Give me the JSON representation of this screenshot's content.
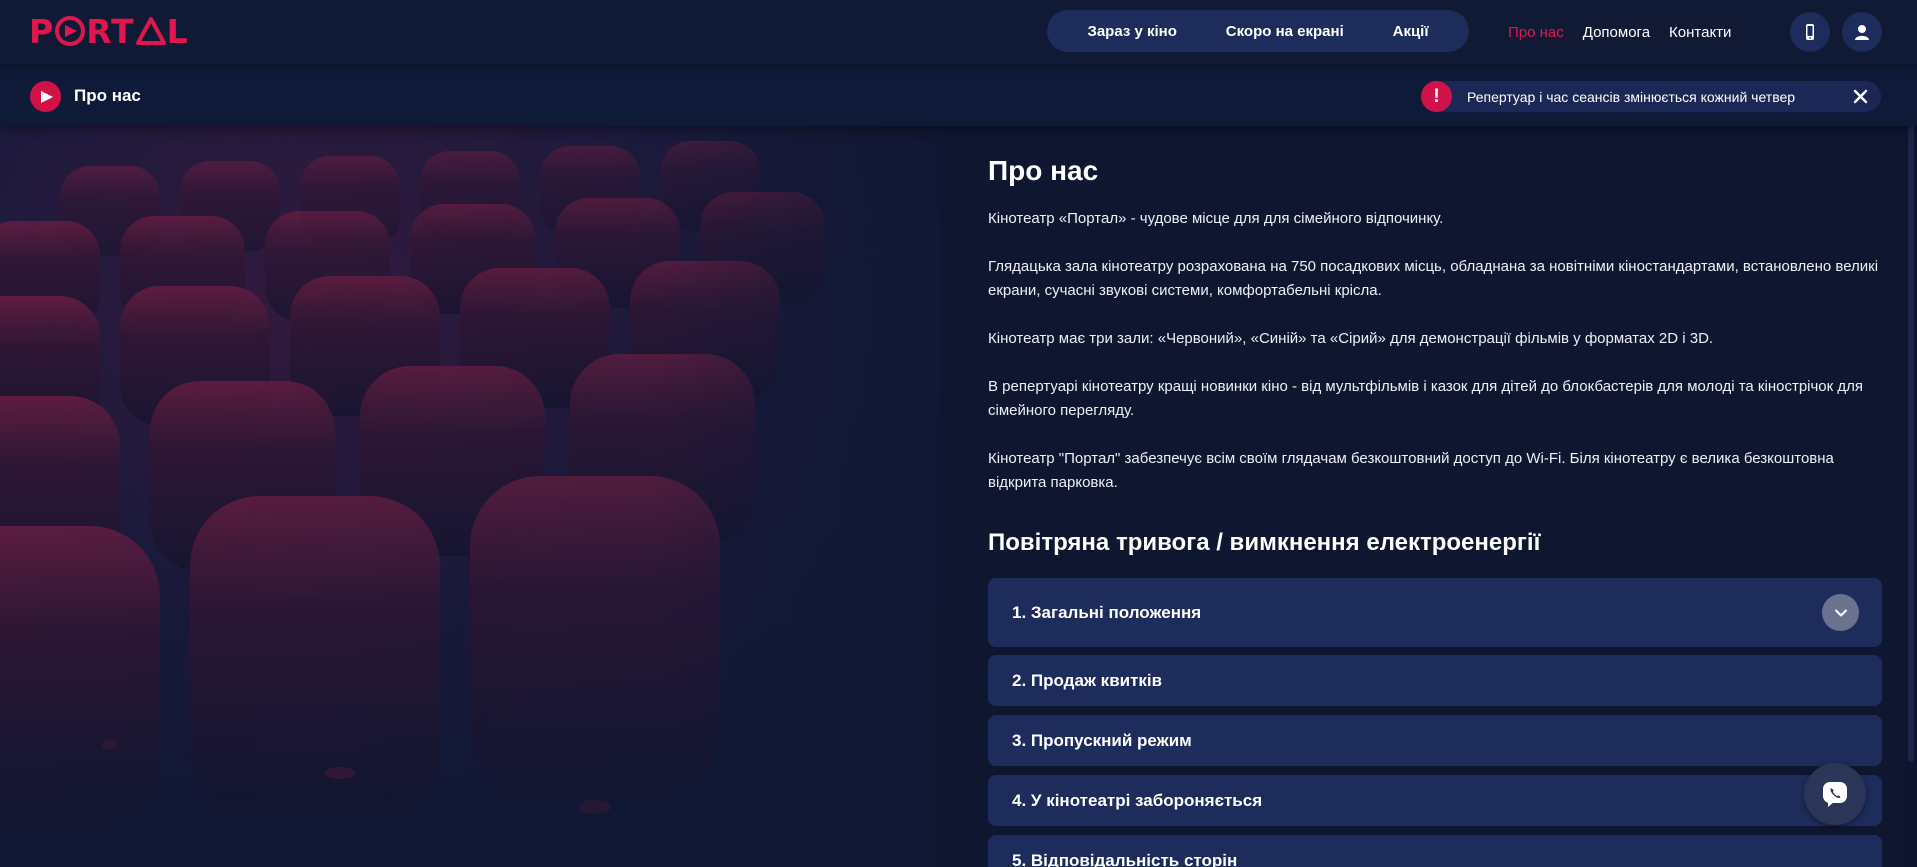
{
  "brand": {
    "logo_text": "PORTAL",
    "accent": "#e0164f"
  },
  "header": {
    "pill_nav": [
      "Зараз у кіно",
      "Скоро на екрані",
      "Акції"
    ],
    "links": [
      "Про нас",
      "Допомога",
      "Контакти"
    ],
    "active_link": "Про нас",
    "icons": [
      "phone-icon",
      "user-icon"
    ]
  },
  "subbar": {
    "breadcrumb": "Про нас",
    "notice_icon": "!",
    "notice_text": "Репертуар і час сеансів змінюється кожний четвер"
  },
  "about": {
    "title": "Про нас",
    "paragraphs": [
      "Кінотеатр «Портал» - чудове місце для для сімейного відпочинку.",
      "Глядацька зала кінотеатру розрахована на 750 посадкових місць, обладнана за новітніми кіностандартами, встановлено великі екрани, сучасні звукові системи, комфортабельні крісла.",
      "Кінотеатр має три зали: «Червоний», «Синій» та «Сірий» для демонстрації фільмів у форматах 2D і 3D.",
      "В репертуарі кінотеатру кращі новинки кіно - від мультфільмів і казок для дітей до блокбастерів для молоді та кінострічок для сімейного перегляду.",
      "Кінотеатр \"Портал\" забезпечує всім своїм глядачам безкоштовний доступ до Wi-Fi. Біля кінотеатру є велика безкоштовна відкрита парковка."
    ],
    "section_title": "Повітряна тривога / вимкнення електроенергії",
    "accordion": [
      "1. Загальні положення",
      "2. Продаж квитків",
      "3. Пропускний режим",
      "4. У кінотеатрі забороняється",
      "5. Відповідальність сторін"
    ]
  },
  "floating": {
    "chat_icon": "viber-icon"
  }
}
